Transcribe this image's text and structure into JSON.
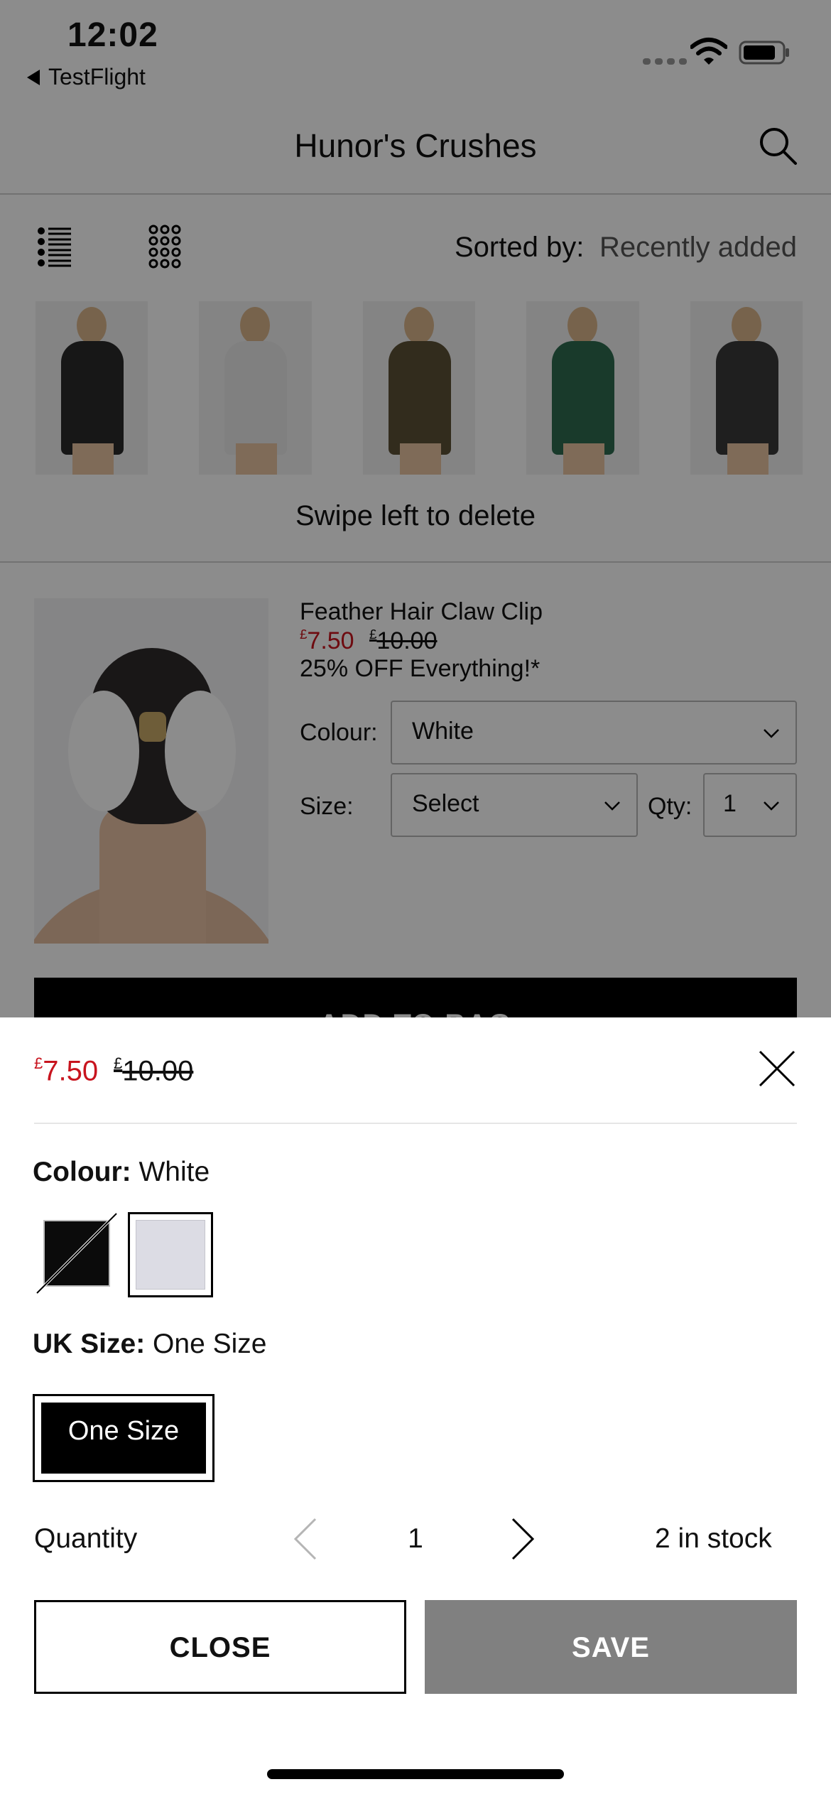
{
  "status_bar": {
    "time": "12:02",
    "back_app": "TestFlight"
  },
  "nav": {
    "title": "Hunor's Crushes"
  },
  "toolbar": {
    "sorted_by_label": "Sorted by:",
    "sorted_by_value": "Recently added"
  },
  "crushes": [
    {
      "name": "crush-thumb-1",
      "color": "#2a2a2a"
    },
    {
      "name": "crush-thumb-2",
      "color": "#e9e9e9"
    },
    {
      "name": "crush-thumb-3",
      "color": "#5c5036"
    },
    {
      "name": "crush-thumb-4",
      "color": "#2f6b4f"
    },
    {
      "name": "crush-thumb-5",
      "color": "#3a3a3a"
    }
  ],
  "swipe_hint": "Swipe left to delete",
  "product": {
    "name": "Feather Hair Claw Clip",
    "currency": "£",
    "sale_price": "7.50",
    "was_price": "10.00",
    "promo": "25% OFF Everything!*",
    "colour_label": "Colour:",
    "colour_value": "White",
    "size_label": "Size:",
    "size_value": "Select",
    "qty_label": "Qty:",
    "qty_value": "1",
    "add_to_bag": "ADD TO BAG"
  },
  "sheet": {
    "currency": "£",
    "sale_price": "7.50",
    "was_price": "10.00",
    "colour_heading": "Colour:",
    "colour_selected": "White",
    "size_heading": "UK Size:",
    "size_selected": "One Size",
    "size_option": "One Size",
    "quantity_label": "Quantity",
    "quantity_value": "1",
    "stock_text": "2 in stock",
    "close_label": "CLOSE",
    "save_label": "SAVE"
  },
  "colors": {
    "sale_red": "#c8141e",
    "save_disabled": "#808080",
    "swatch_white": "#dcdce4"
  }
}
